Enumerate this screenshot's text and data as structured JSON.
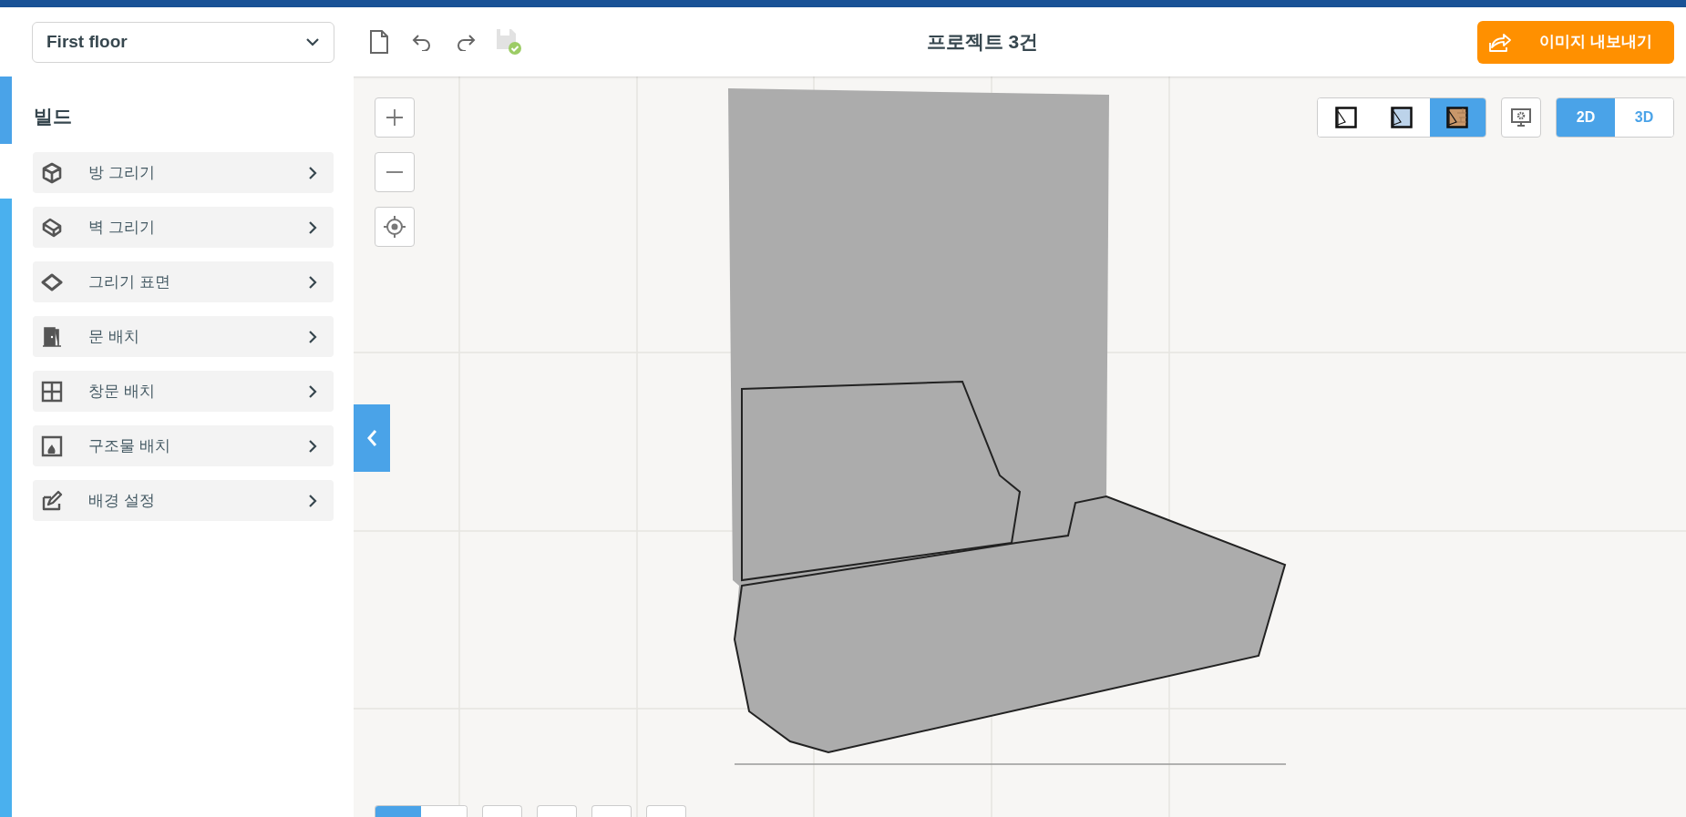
{
  "floor_select": {
    "value": "First floor"
  },
  "project_title": "프로젝트 3건",
  "export_button": {
    "label": "이미지 내보내기"
  },
  "sidebar": {
    "heading": "빌드",
    "items": [
      {
        "label": "방 그리기",
        "kind": "room"
      },
      {
        "label": "벽 그리기",
        "kind": "wall"
      },
      {
        "label": "그리기 표면",
        "kind": "surface"
      },
      {
        "label": "문 배치",
        "kind": "door"
      },
      {
        "label": "창문 배치",
        "kind": "window"
      },
      {
        "label": "구조물 배치",
        "kind": "structure"
      },
      {
        "label": "배경 설정",
        "kind": "background"
      }
    ]
  },
  "view_modes": [
    {
      "kind": "outline",
      "selected": false
    },
    {
      "kind": "filled",
      "selected": false
    },
    {
      "kind": "textured",
      "selected": true
    }
  ],
  "dimension_toggle": [
    {
      "label": "2D",
      "selected": true
    },
    {
      "label": "3D",
      "selected": false
    }
  ],
  "bottom_toolbar": {
    "segments": [
      {
        "selected": true
      },
      {
        "selected": false
      }
    ]
  }
}
